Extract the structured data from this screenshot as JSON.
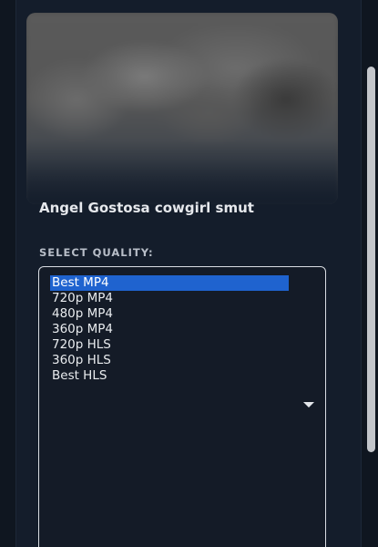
{
  "video": {
    "title": "Angel Gostosa cowgirl smut"
  },
  "quality_selector": {
    "label": "SELECT QUALITY:",
    "selected": "Best MP4",
    "options": [
      "Best MP4",
      "720p MP4",
      "480p MP4",
      "360p MP4",
      "720p HLS",
      "360p HLS",
      "Best HLS"
    ]
  },
  "icons": {
    "dropdown": "chevron-down-icon"
  },
  "colors": {
    "background": "#0f1620",
    "panel": "#141d2b",
    "selected_option": "#1f63cf",
    "text": "#e6e8ec"
  }
}
